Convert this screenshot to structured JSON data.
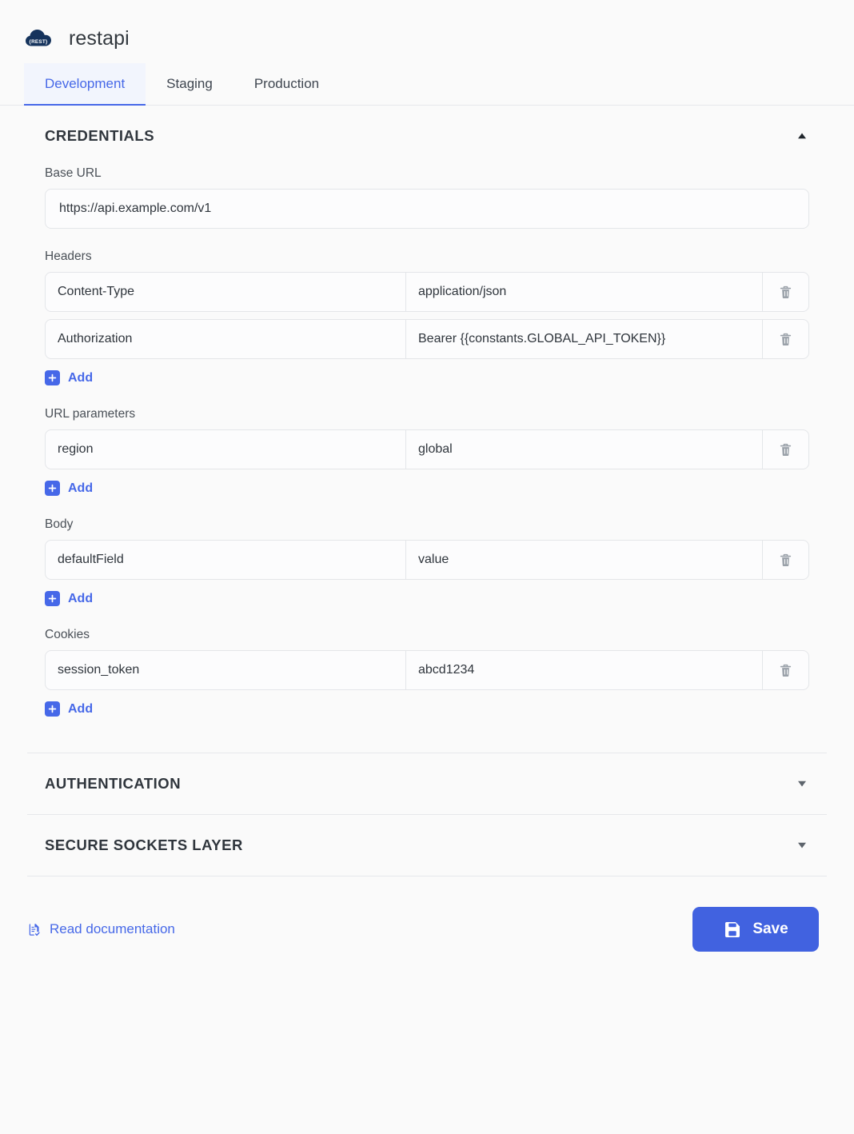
{
  "header": {
    "logo_icon": "rest-cloud-logo-icon",
    "logo_text": "{REST}",
    "title": "restapi"
  },
  "tabs": [
    {
      "label": "Development",
      "active": true
    },
    {
      "label": "Staging",
      "active": false
    },
    {
      "label": "Production",
      "active": false
    }
  ],
  "sections": {
    "credentials": {
      "title": "CREDENTIALS",
      "expanded": true,
      "caret_icon": "caret-up-icon",
      "base_url": {
        "label": "Base URL",
        "value": "https://api.example.com/v1",
        "placeholder": "https://api.example.com/v1"
      },
      "headers": {
        "label": "Headers",
        "rows": [
          {
            "key": "Content-Type",
            "value": "application/json"
          },
          {
            "key": "Authorization",
            "value": "Bearer {{constants.GLOBAL_API_TOKEN}}"
          }
        ],
        "add_label": "Add"
      },
      "url_parameters": {
        "label": "URL parameters",
        "rows": [
          {
            "key": "region",
            "value": "global"
          }
        ],
        "add_label": "Add"
      },
      "body": {
        "label": "Body",
        "rows": [
          {
            "key": "defaultField",
            "value": "value"
          }
        ],
        "add_label": "Add"
      },
      "cookies": {
        "label": "Cookies",
        "rows": [
          {
            "key": "session_token",
            "value": "abcd1234"
          }
        ],
        "add_label": "Add"
      }
    },
    "authentication": {
      "title": "AUTHENTICATION",
      "expanded": false,
      "caret_icon": "caret-down-icon"
    },
    "ssl": {
      "title": "SECURE SOCKETS LAYER",
      "expanded": false,
      "caret_icon": "caret-down-icon"
    }
  },
  "footer": {
    "doc_link_label": "Read documentation",
    "doc_link_icon": "document-check-icon",
    "save_label": "Save",
    "save_icon": "floppy-disk-save-icon"
  },
  "colors": {
    "accent": "#4668e8",
    "save_button": "#4162e0",
    "logo_navy": "#15335c",
    "page_background": "#fafafa",
    "text_primary": "#30363d",
    "border": "#e4e6e9"
  }
}
